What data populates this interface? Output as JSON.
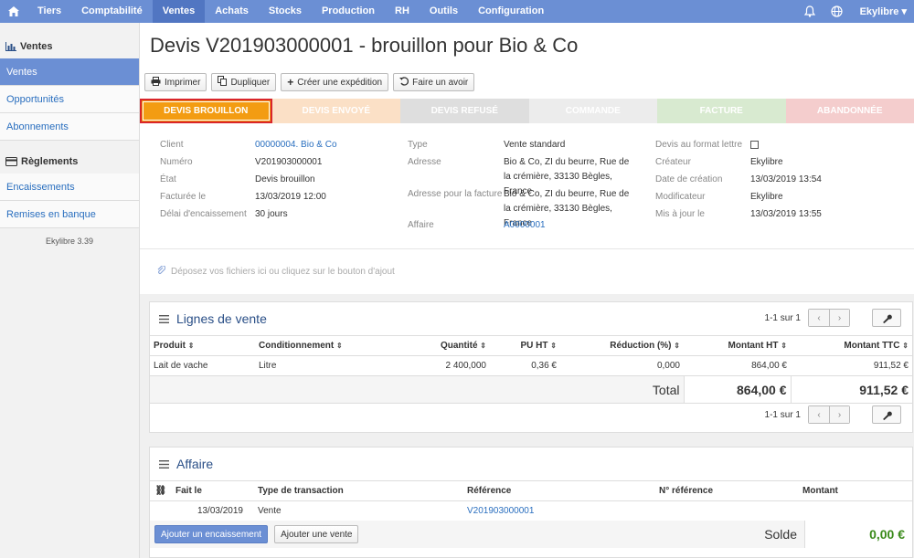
{
  "nav": {
    "items": [
      "Tiers",
      "Comptabilité",
      "Ventes",
      "Achats",
      "Stocks",
      "Production",
      "RH",
      "Outils",
      "Configuration"
    ],
    "active": "Ventes",
    "user": "Ekylibre"
  },
  "sidebar": {
    "section1": "Ventes",
    "items1": [
      "Ventes",
      "Opportunités",
      "Abonnements"
    ],
    "section2": "Règlements",
    "items2": [
      "Encaissements",
      "Remises en banque"
    ],
    "version": "Ekylibre 3.39"
  },
  "page": {
    "title": "Devis V201903000001 - brouillon pour Bio & Co"
  },
  "toolbar": {
    "print": "Imprimer",
    "duplicate": "Dupliquer",
    "shipment": "Créer une expédition",
    "credit": "Faire un avoir"
  },
  "steps": [
    "DEVIS BROUILLON",
    "DEVIS ENVOYÉ",
    "DEVIS REFUSÉ",
    "COMMANDE",
    "FACTURE",
    "ABANDONNÉE"
  ],
  "details": {
    "client_label": "Client",
    "client": "00000004. Bio & Co",
    "numero_label": "Numéro",
    "numero": "V201903000001",
    "etat_label": "État",
    "etat": "Devis brouillon",
    "facturee_label": "Facturée le",
    "facturee": "13/03/2019 12:00",
    "delai_label": "Délai d'encaissement",
    "delai": "30 jours",
    "type_label": "Type",
    "type": "Vente standard",
    "adresse_label": "Adresse",
    "adresse": "Bio & Co, ZI du beurre, Rue de la crémière, 33130 Bègles, France",
    "adresse_fact_label": "Adresse pour la facture",
    "adresse_fact": "Bio & Co, ZI du beurre, Rue de la crémière, 33130 Bègles, France",
    "affaire_label": "Affaire",
    "affaire": "A0000001",
    "format_label": "Devis au format lettre",
    "createur_label": "Créateur",
    "createur": "Ekylibre",
    "date_creation_label": "Date de création",
    "date_creation": "13/03/2019 13:54",
    "modificateur_label": "Modificateur",
    "modificateur": "Ekylibre",
    "maj_label": "Mis à jour le",
    "maj": "13/03/2019 13:55"
  },
  "dropzone": "Déposez vos fichiers ici ou cliquez sur le bouton d'ajout",
  "lines": {
    "title": "Lignes de vente",
    "pager": "1-1 sur 1",
    "columns": [
      "Produit",
      "Conditionnement",
      "Quantité",
      "PU HT",
      "Réduction (%)",
      "Montant HT",
      "Montant TTC"
    ],
    "rows": [
      [
        "Lait de vache",
        "Litre",
        "2 400,000",
        "0,36 €",
        "0,000",
        "864,00 €",
        "911,52 €"
      ]
    ],
    "total_label": "Total",
    "total_ht": "864,00 €",
    "total_ttc": "911,52 €"
  },
  "affair": {
    "title": "Affaire",
    "columns": [
      "Fait le",
      "Type de transaction",
      "Référence",
      "N° référence",
      "Montant"
    ],
    "rows": [
      [
        "13/03/2019",
        "Vente",
        "V201903000001",
        "",
        ""
      ]
    ],
    "add_payment": "Ajouter un encaissement",
    "add_sale": "Ajouter une vente",
    "balance_label": "Solde",
    "balance": "0,00 €"
  }
}
